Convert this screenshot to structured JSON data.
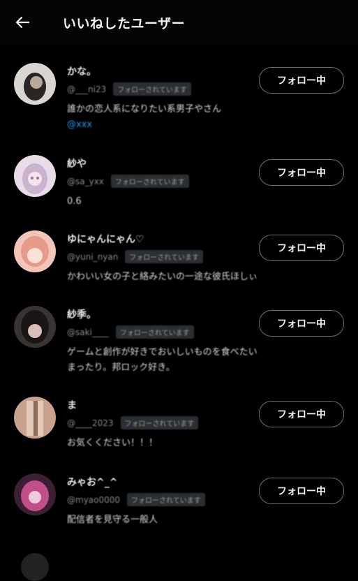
{
  "header": {
    "title": "いいねしたユーザー"
  },
  "users": [
    {
      "name": "かな。",
      "handle": "@___ni23",
      "follows_you": "フォローされています",
      "bio": "誰かの恋人系になりたい系男子やさん",
      "mention": "@xxx",
      "button": "フォロー中"
    },
    {
      "name": "紗や",
      "handle": "@sa_yxx",
      "follows_you": "フォローされています",
      "bio": "0.6",
      "mention": "",
      "button": "フォロー中"
    },
    {
      "name": "ゆにゃんにゃん♡",
      "handle": "@yuni_nyan",
      "follows_you": "フォローされています",
      "bio": "かわいい女の子と絡みたいの一途な彼氏ほしぃ",
      "mention": "",
      "button": "フォロー中"
    },
    {
      "name": "紗季。",
      "handle": "@saki____",
      "follows_you": "フォローされています",
      "bio": "ゲームと創作が好きでおいしいものを食べたい",
      "bio2": "まったり。邦ロック好き。",
      "mention": "",
      "button": "フォロー中"
    },
    {
      "name": "ま",
      "handle": "@____2023",
      "follows_you": "フォローされています",
      "bio": "お気くください！！！",
      "mention": "",
      "button": "フォロー中"
    },
    {
      "name": "みゃお^_^",
      "handle": "@myao0000",
      "follows_you": "フォローされています",
      "bio": "配信者を見守る一般人",
      "mention": "",
      "button": "フォロー中"
    }
  ]
}
